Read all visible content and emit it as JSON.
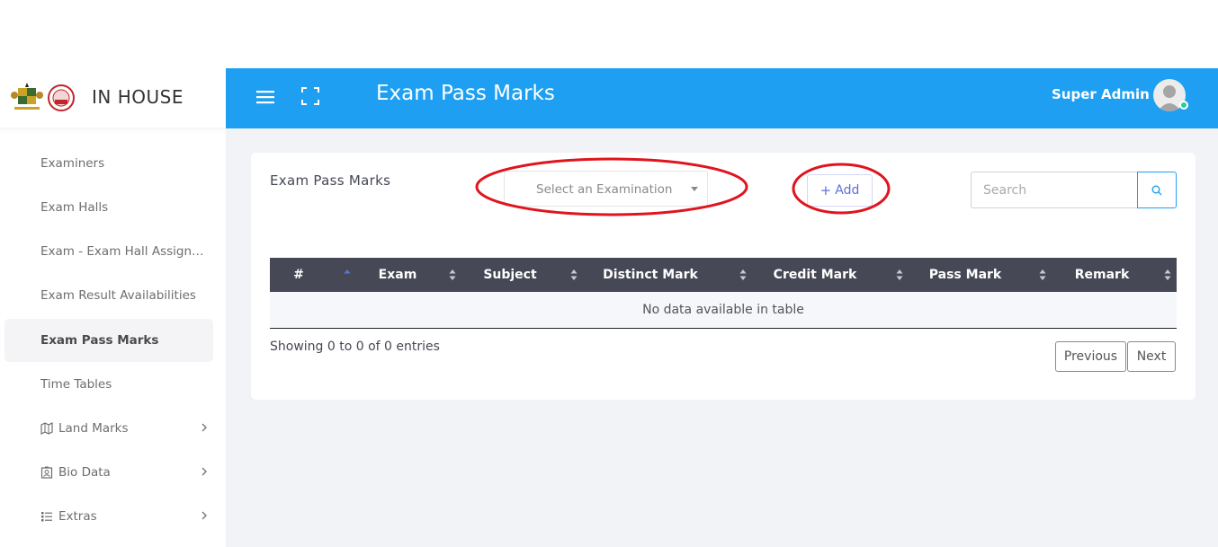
{
  "brand": {
    "name": "IN HOUSE",
    "logo_left": "ghana-coat-of-arms",
    "logo_right": "institution-seal"
  },
  "sidebar": {
    "items": [
      {
        "label": "Examiners",
        "icon": ""
      },
      {
        "label": "Exam Halls",
        "icon": ""
      },
      {
        "label": "Exam - Exam Hall Assignm...",
        "icon": ""
      },
      {
        "label": "Exam Result Availabilities",
        "icon": ""
      },
      {
        "label": "Exam Pass Marks",
        "icon": "",
        "active": true
      },
      {
        "label": "Time Tables",
        "icon": ""
      },
      {
        "label": "Land Marks",
        "icon": "map-icon",
        "has_submenu": true
      },
      {
        "label": "Bio Data",
        "icon": "id-badge-icon",
        "has_submenu": true
      },
      {
        "label": "Extras",
        "icon": "list-icon",
        "has_submenu": true
      }
    ]
  },
  "header": {
    "title": "Exam Pass Marks",
    "user_name": "Super Admin",
    "menu_icon": "hamburger-icon",
    "fullscreen_icon": "expand-icon",
    "status_color": "#28d094",
    "bar_color": "#1e9ff2"
  },
  "main": {
    "card_title": "Exam Pass Marks",
    "exam_select": {
      "selected": "Select an Examination"
    },
    "add_button": {
      "label": "Add",
      "icon": "plus-icon"
    },
    "search": {
      "placeholder": "Search",
      "icon": "search-icon"
    },
    "table": {
      "columns": [
        "#",
        "Exam",
        "Subject",
        "Distinct Mark",
        "Credit Mark",
        "Pass Mark",
        "Remark"
      ],
      "empty_message": "No data available in table"
    },
    "info": "Showing 0 to 0 of 0 entries",
    "pagination": {
      "previous": "Previous",
      "next": "Next"
    },
    "annotation_color": "#e0141e"
  }
}
